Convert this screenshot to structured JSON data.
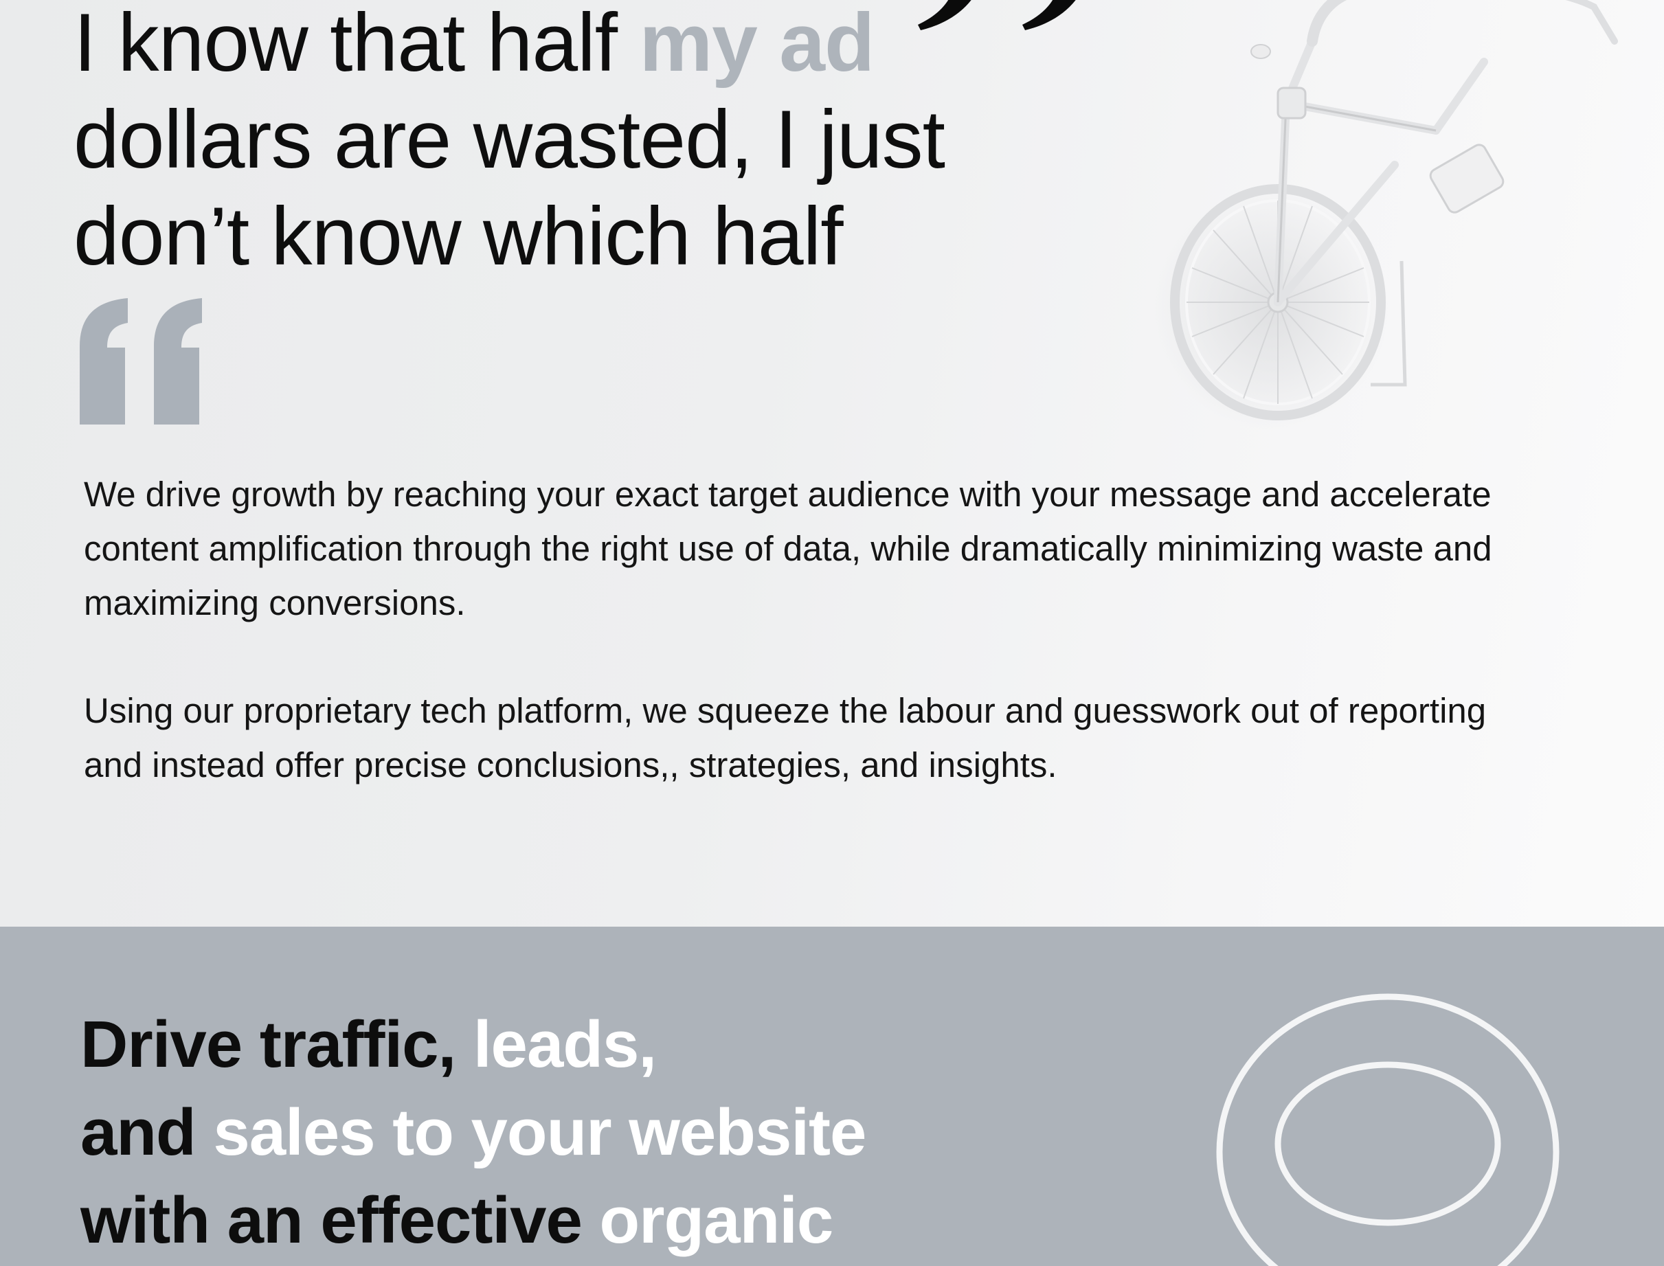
{
  "hero": {
    "headline_line1_dark": "I know that half ",
    "headline_line1_accent": "my ad",
    "headline_line2": "dollars are wasted, I just",
    "headline_line3": "don’t know which half"
  },
  "intro": {
    "paragraph_1": "We drive growth by reaching your exact target audience with your message and accelerate content amplification through the right use of data, while dramatically minimizing waste and maximizing conversions.",
    "paragraph_2": "Using our proprietary tech platform, we squeeze the labour and guesswork  out of reporting and instead offer precise conclusions,, strategies, and insights."
  },
  "cta": {
    "line1_dark": "Drive traffic, ",
    "line1_light": "leads,",
    "line2_dark": "and ",
    "line2_light": "sales to your website",
    "line3_dark": "with an effective ",
    "line3_light": "organic"
  },
  "colors": {
    "accent_grey": "#aeb4bb",
    "band_grey": "#adb3ba",
    "text_dark": "#0e0e0e",
    "text_light": "#ffffff"
  },
  "icons": {
    "open_quote": "open-quote-icon",
    "close_quote": "close-quote-icon",
    "bicycle": "bicycle-illustration",
    "rings": "concentric-rings-graphic"
  }
}
